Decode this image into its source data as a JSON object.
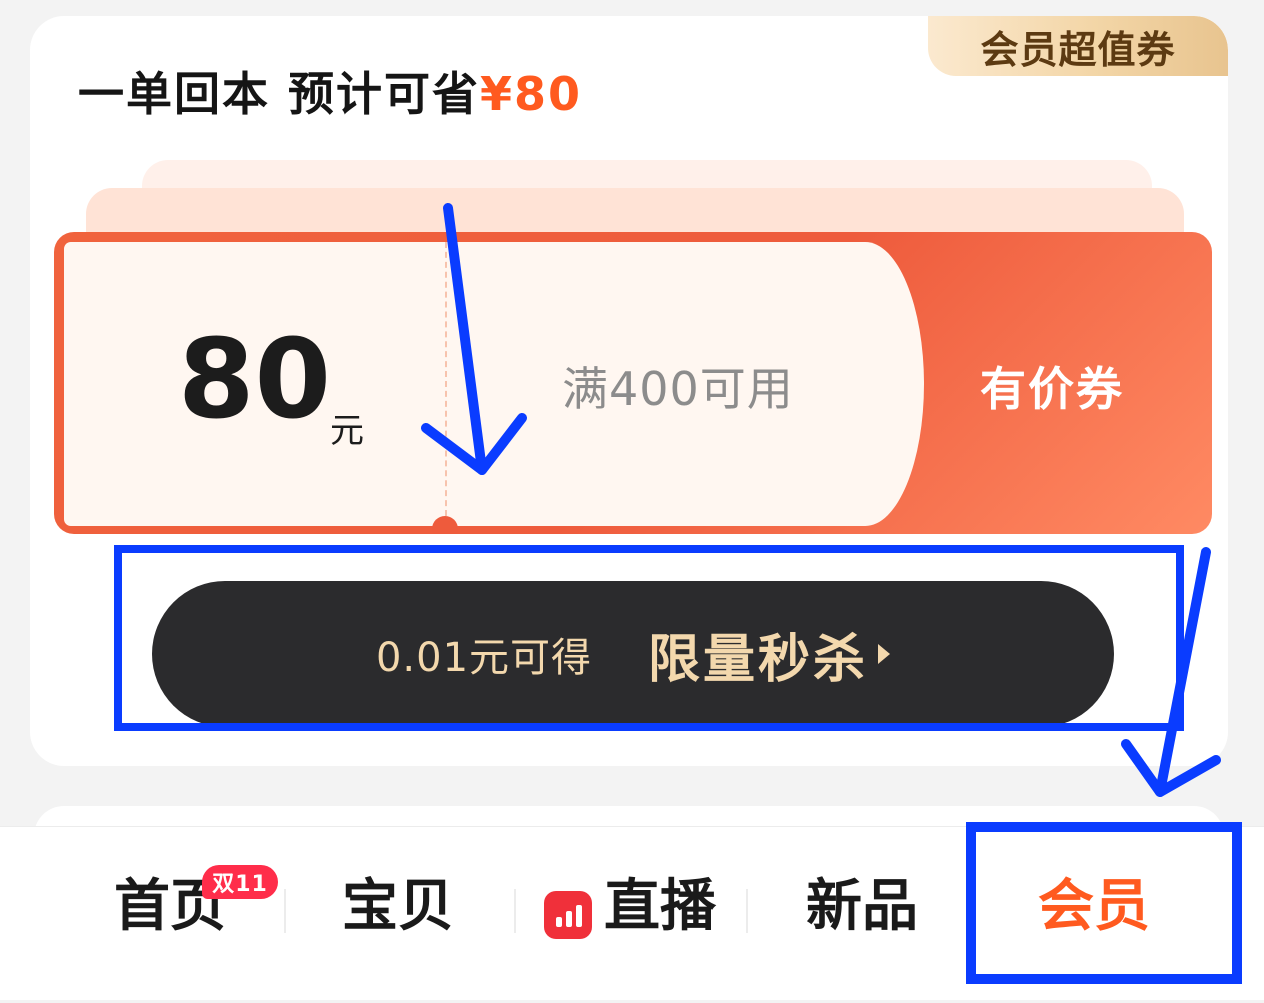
{
  "colors": {
    "accent": "#ff5a1f",
    "annotation_blue": "#0a3cff",
    "coupon_red": "#ee5b3c",
    "button_dark": "#2b2b2d",
    "button_text": "#f3d8ad"
  },
  "card": {
    "tag": "会员超值券",
    "headline_prefix": "一单回本 预计可省",
    "headline_value": "¥80"
  },
  "coupon": {
    "amount": "80",
    "unit": "元",
    "condition": "满400可用",
    "type": "有价券"
  },
  "action": {
    "sub_label": "0.01元可得",
    "main_label": "限量秒杀"
  },
  "tabbar": {
    "tabs": [
      {
        "label": "首页",
        "badge": "双11"
      },
      {
        "label": "宝贝"
      },
      {
        "label": "直播",
        "icon": "live-bars-icon"
      },
      {
        "label": "新品"
      },
      {
        "label": "会员",
        "active": true
      }
    ]
  },
  "annotations": {
    "shapes": [
      "arrow",
      "box",
      "arrow",
      "box"
    ]
  }
}
